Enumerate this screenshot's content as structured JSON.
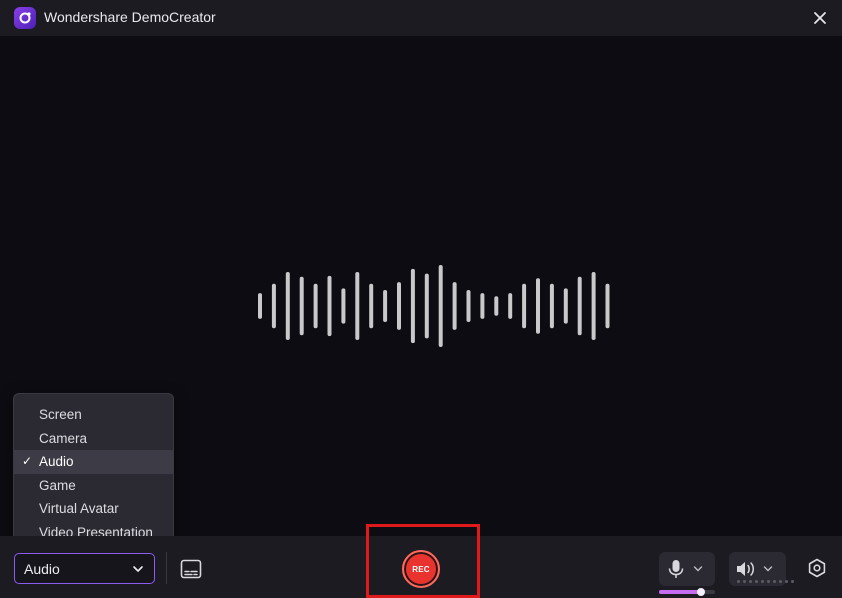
{
  "window": {
    "title": "Wondershare DemoCreator",
    "logo_icon": "democreator-logo-icon",
    "close_icon": "close-icon"
  },
  "waveform": {
    "bar_levels": [
      0.28,
      0.52,
      0.82,
      0.7,
      0.52,
      0.72,
      0.4,
      0.82,
      0.52,
      0.36,
      0.56,
      0.9,
      0.78,
      1.0,
      0.56,
      0.36,
      0.28,
      0.2,
      0.28,
      0.52,
      0.66,
      0.52,
      0.4,
      0.7,
      0.82,
      0.52
    ],
    "color": "#c9c9cc"
  },
  "mode_menu": {
    "items": [
      {
        "label": "Screen",
        "selected": false
      },
      {
        "label": "Camera",
        "selected": false
      },
      {
        "label": "Audio",
        "selected": true
      },
      {
        "label": "Game",
        "selected": false
      },
      {
        "label": "Virtual Avatar",
        "selected": false
      },
      {
        "label": "Video Presentation",
        "selected": false
      }
    ],
    "check_glyph": "✓"
  },
  "toolbar": {
    "mode_select_value": "Audio",
    "caption_icon": "caption-icon",
    "rec_label": "REC",
    "rec_color": "#e8332f",
    "mic_icon": "microphone-icon",
    "mic_level": 0.75,
    "speaker_icon": "speaker-icon",
    "settings_icon": "settings-icon",
    "highlight_color": "#e01a1a"
  }
}
